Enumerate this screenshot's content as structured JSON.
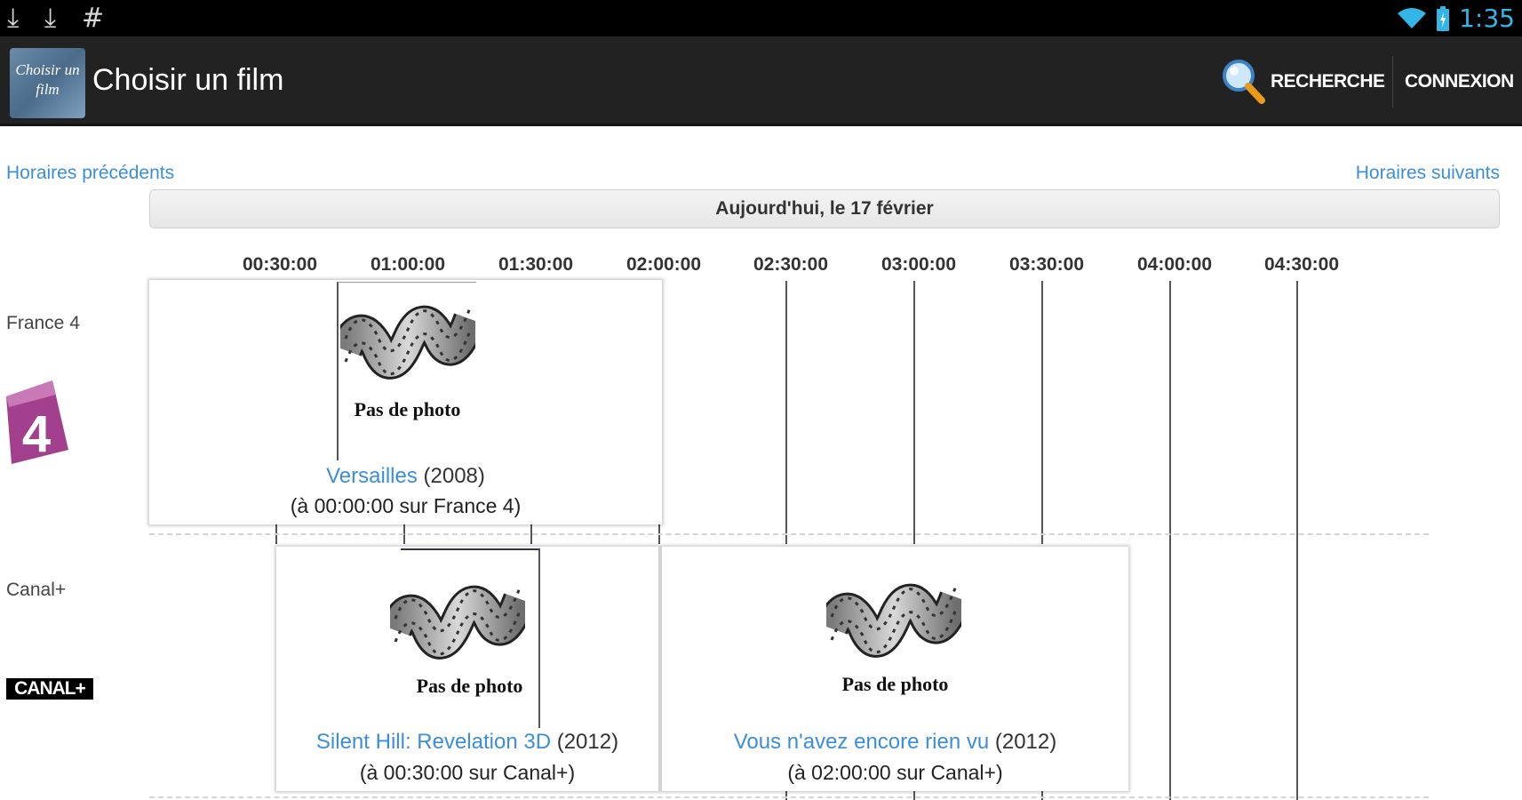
{
  "status_bar": {
    "icons": [
      "download-icon",
      "download-icon",
      "hash-icon",
      "wifi-icon",
      "battery-icon"
    ],
    "time": "1:35"
  },
  "action_bar": {
    "logo_text": "Choisir un film",
    "title": "Choisir un film",
    "search_label": "RECHERCHE",
    "login_label": "CONNEXION"
  },
  "nav": {
    "prev": "Horaires précédents",
    "next": "Horaires suivants"
  },
  "date": "Aujourd'hui, le 17 février",
  "timeline": [
    "00:30:00",
    "01:00:00",
    "01:30:00",
    "02:00:00",
    "02:30:00",
    "03:00:00",
    "03:30:00",
    "04:00:00",
    "04:30:00"
  ],
  "channels": [
    {
      "name": "France 4",
      "logo_text": "4",
      "programs": [
        {
          "no_photo": "Pas de photo",
          "title": "Versailles",
          "year": "(2008)",
          "time": "(à 00:00:00 sur France 4)"
        }
      ]
    },
    {
      "name": "Canal+",
      "logo_text": "CANAL+",
      "programs": [
        {
          "no_photo": "Pas de photo",
          "title": "Silent Hill: Revelation 3D",
          "year": "(2012)",
          "time": "(à 00:30:00 sur Canal+)"
        },
        {
          "no_photo": "Pas de photo",
          "title": "Vous n'avez encore rien vu",
          "year": "(2012)",
          "time": "(à 02:00:00 sur Canal+)"
        }
      ]
    }
  ]
}
